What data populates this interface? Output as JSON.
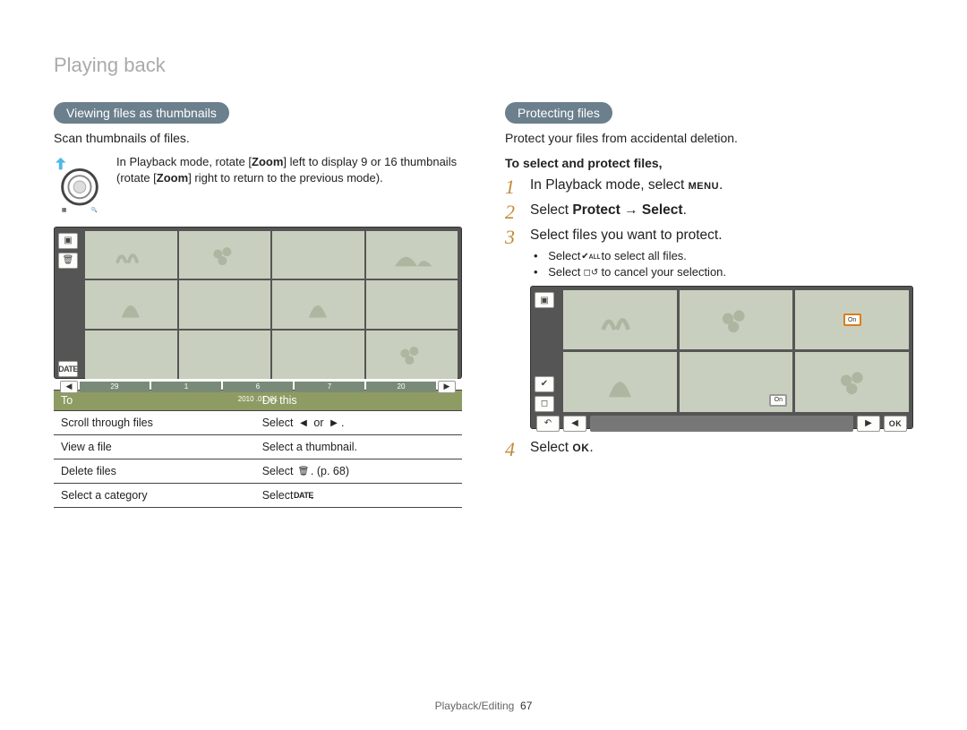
{
  "page_title": "Playing back",
  "left": {
    "pill": "Viewing files as thumbnails",
    "subtitle": "Scan thumbnails of files.",
    "instruction_pre": "In Playback mode, rotate [",
    "instruction_bold1": "Zoom",
    "instruction_mid": "] left to display 9 or 16 thumbnails (rotate [",
    "instruction_bold2": "Zoom",
    "instruction_post": "] right to return to the previous mode).",
    "footer_cells": [
      "29",
      "1",
      "6",
      "7",
      "20"
    ],
    "footer_date": "2010 .01. 01",
    "table": {
      "head_to": "To",
      "head_do": "Do this",
      "rows": [
        {
          "to": "Scroll through files",
          "do_pre": "Select ",
          "do_icons": [
            "◀",
            " or ",
            "▶"
          ],
          "do_post": "."
        },
        {
          "to": "View a file",
          "do_pre": "Select a thumbnail.",
          "do_icons": [],
          "do_post": ""
        },
        {
          "to": "Delete files",
          "do_pre": "Select ",
          "do_icons": [
            "🗑"
          ],
          "do_post": ". (p. 68)"
        },
        {
          "to": "Select a category",
          "do_pre": "Select ",
          "do_icons": [
            "DATE"
          ],
          "do_post": "."
        }
      ]
    }
  },
  "right": {
    "pill": "Protecting files",
    "subtitle": "Protect your files from accidental deletion.",
    "bold_sub": "To select and protect files,",
    "steps": {
      "s1_pre": "In Playback mode, select ",
      "s1_icon": "MENU",
      "s1_post": ".",
      "s2_pre": "Select ",
      "s2_b1": "Protect",
      "s2_arrow": " → ",
      "s2_b2": "Select",
      "s2_post": ".",
      "s3": "Select files you want to protect.",
      "s3_sub1_pre": "Select ",
      "s3_sub1_icon": "✔ᴀʟʟ",
      "s3_sub1_post": " to select all files.",
      "s3_sub2_pre": "Select ",
      "s3_sub2_icon": "◻↺",
      "s3_sub2_post": " to cancel your selection.",
      "s4_pre": "Select ",
      "s4_icon": "OK",
      "s4_post": ".",
      "protect_label": "On"
    }
  },
  "footer": {
    "section": "Playback/Editing",
    "page": "67"
  }
}
